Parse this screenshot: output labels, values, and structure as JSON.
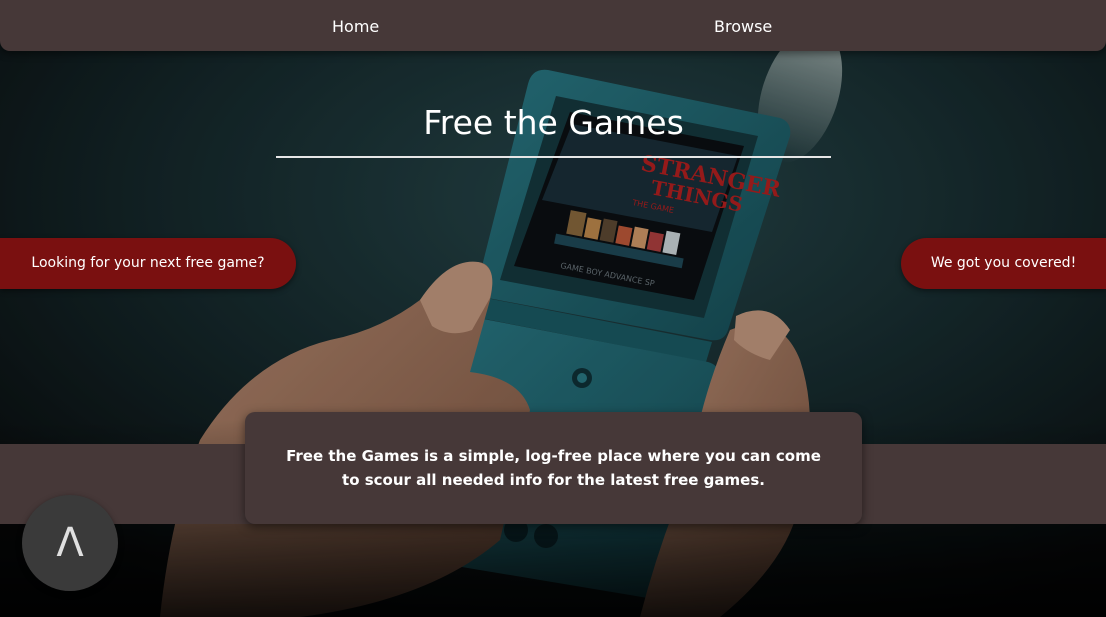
{
  "nav": {
    "home_label": "Home",
    "browse_label": "Browse"
  },
  "hero": {
    "title": "Free the Games",
    "left_pill": "Looking for your next free game?",
    "right_pill": "We got you covered!"
  },
  "about": {
    "text": "Free the Games is a simple, log-free place where you can come to scour all needed info for the latest free games."
  },
  "scroll_top": {
    "label": "Λ"
  },
  "colors": {
    "nav_bg": "#463838",
    "pill_red": "#7a1010",
    "console_teal": "#1d5a64",
    "background_dark": "#0d0d0d"
  },
  "background_image": {
    "subject": "hands holding a teal handheld game console",
    "screen_logo": "STRANGER THINGS THE GAME",
    "device_text": "GAME BOY ADVANCE SP"
  }
}
